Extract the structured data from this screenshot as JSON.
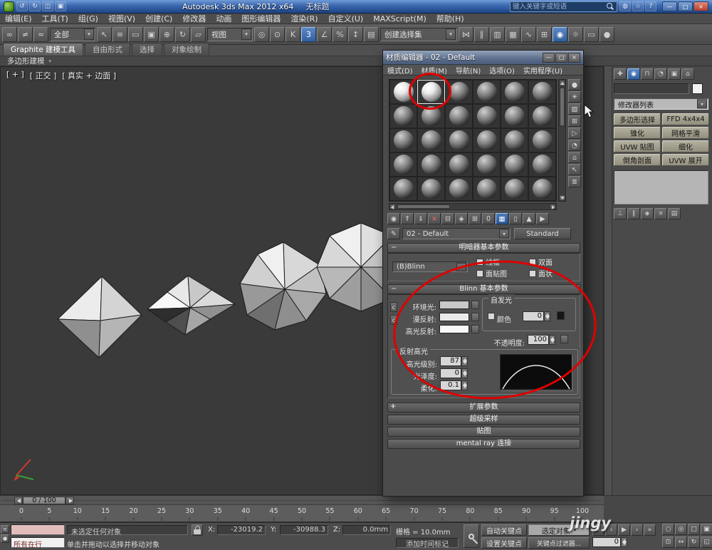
{
  "colors": {
    "annotation_red": "#df0000",
    "accent_blue": "#3a6aa8",
    "ambient": "#c8c8c8",
    "diffuse": "#eaeaea",
    "specular": "#f8f8f8",
    "selfillum_swatch": "#161616"
  },
  "titlebar": {
    "app_title": "Autodesk 3ds Max 2012 x64",
    "doc_title": "无标题",
    "search_placeholder": "键入关键字或短语",
    "qat": [
      {
        "n": "undo-icon",
        "g": "↺"
      },
      {
        "n": "redo-icon",
        "g": "↻"
      },
      {
        "n": "open-file-icon",
        "g": "◫"
      },
      {
        "n": "save-file-icon",
        "g": "▣"
      }
    ],
    "right_icons": [
      {
        "n": "communication-center-icon",
        "g": "◍"
      },
      {
        "n": "favorites-star-icon",
        "g": "☆"
      },
      {
        "n": "help-icon",
        "g": "?"
      }
    ],
    "window_buttons": {
      "minimize": "—",
      "maximize": "□",
      "close": "×"
    }
  },
  "menubar": {
    "items": [
      "编辑(E)",
      "工具(T)",
      "组(G)",
      "视图(V)",
      "创建(C)",
      "修改器",
      "动画",
      "图形编辑器",
      "渲染(R)",
      "自定义(U)",
      "MAXScript(M)",
      "帮助(H)"
    ]
  },
  "toolbar": {
    "icons_a": [
      {
        "n": "select-and-link-icon",
        "g": "∞"
      },
      {
        "n": "unlink-selection-icon",
        "g": "≠"
      },
      {
        "n": "bind-to-space-warp-icon",
        "g": "≈"
      }
    ],
    "selection_filter": "全部",
    "icons_b": [
      {
        "n": "select-object-icon",
        "g": "↖"
      },
      {
        "n": "select-by-name-icon",
        "g": "≡"
      },
      {
        "n": "rectangular-selection-icon",
        "g": "▭"
      },
      {
        "n": "window-crossing-icon",
        "g": "▣"
      },
      {
        "n": "select-and-move-icon",
        "g": "⊕"
      },
      {
        "n": "select-and-rotate-icon",
        "g": "↻"
      },
      {
        "n": "select-and-scale-icon",
        "g": "▱"
      }
    ],
    "coordinate_system": "视图",
    "icons_c": [
      {
        "n": "use-pivot-center-icon",
        "g": "◎"
      },
      {
        "n": "select-and-manipulate-icon",
        "g": "⊙"
      },
      {
        "n": "keyboard-override-icon",
        "g": "K"
      },
      {
        "n": "snap-toggle-3d-icon",
        "g": "3",
        "a": true
      },
      {
        "n": "angle-snap-icon",
        "g": "∠"
      },
      {
        "n": "percent-snap-icon",
        "g": "%"
      },
      {
        "n": "spinner-snap-icon",
        "g": "↕"
      },
      {
        "n": "edit-named-selection-sets-icon",
        "g": "▤"
      }
    ],
    "selection_set": "创建选择集",
    "icons_d": [
      {
        "n": "mirror-icon",
        "g": "⋈"
      },
      {
        "n": "align-icon",
        "g": "∥"
      },
      {
        "n": "layer-manager-icon",
        "g": "▥"
      },
      {
        "n": "graphite-toggle-icon",
        "g": "▦"
      },
      {
        "n": "curve-editor-icon",
        "g": "∿"
      },
      {
        "n": "schematic-view-icon",
        "g": "⊞"
      },
      {
        "n": "material-editor-icon",
        "g": "◉",
        "a": true
      },
      {
        "n": "render-setup-icon",
        "g": "☼"
      },
      {
        "n": "rendered-frame-icon",
        "g": "▭"
      },
      {
        "n": "render-production-icon",
        "g": "●"
      }
    ]
  },
  "ribbon": {
    "tabs": [
      "Graphite 建模工具",
      "自由形式",
      "选择",
      "对象绘制"
    ],
    "panel": "多边形建模"
  },
  "viewport": {
    "overlay": {
      "plus": "[ + ]",
      "view": "[ 正交 ]",
      "shading": "[ 真实 + 边面 ]"
    }
  },
  "material_editor": {
    "title": "材质编辑器 - 02 - Default",
    "window_buttons": {
      "minimize": "—",
      "maximize": "□",
      "close": "×"
    },
    "menu": [
      "模式(D)",
      "材质(M)",
      "导航(N)",
      "选项(O)",
      "实用程序(U)"
    ],
    "sample_slots": {
      "rows": 5,
      "cols": 6,
      "bright_slots": [
        0,
        1
      ],
      "active_slot": 1
    },
    "vertical_tools": [
      {
        "n": "sample-type-icon",
        "g": "●"
      },
      {
        "n": "backlight-icon",
        "g": "☀"
      },
      {
        "n": "background-icon",
        "g": "▨"
      },
      {
        "n": "sample-uv-tiling-icon",
        "g": "⊞"
      },
      {
        "n": "video-color-check-icon",
        "g": "▷"
      },
      {
        "n": "make-preview-icon",
        "g": "◔"
      },
      {
        "n": "material-options-icon",
        "g": "⌂"
      },
      {
        "n": "select-by-material-icon",
        "g": "↖"
      },
      {
        "n": "material-map-navigator-icon",
        "g": "≣"
      }
    ],
    "horizontal_tools": [
      {
        "n": "get-material-icon",
        "g": "◉"
      },
      {
        "n": "put-material-to-scene-icon",
        "g": "⇑"
      },
      {
        "n": "assign-material-to-selection-icon",
        "g": "⇓"
      },
      {
        "n": "reset-map-icon",
        "g": "×",
        "red": true
      },
      {
        "n": "make-material-copy-icon",
        "g": "⊟"
      },
      {
        "n": "make-unique-icon",
        "g": "◈"
      },
      {
        "n": "put-to-library-icon",
        "g": "⊞"
      },
      {
        "n": "material-id-channel-icon",
        "g": "0"
      },
      {
        "n": "show-shaded-material-in-viewport-icon",
        "g": "▦",
        "a": true
      },
      {
        "n": "show-end-result-icon",
        "g": "▯"
      },
      {
        "n": "go-to-parent-icon",
        "g": "▲"
      },
      {
        "n": "go-forward-to-sibling-icon",
        "g": "▶"
      }
    ],
    "pick_icon": "✎",
    "name_field": "02 - Default",
    "type_button": "Standard",
    "rollout_shader": {
      "title": "明暗器基本参数",
      "shader": "(B)Blinn",
      "checks": [
        "线框",
        "双面",
        "面贴图",
        "面状"
      ]
    },
    "rollout_blinn": {
      "title": "Blinn 基本参数",
      "ambient_label": "环境光:",
      "diffuse_label": "漫反射:",
      "specular_label": "高光反射:",
      "selfillum_group": "自发光",
      "color_check": "颜色",
      "selfillum_value": "0",
      "opacity_label": "不透明度:",
      "opacity_value": "100",
      "highlight_group": "反射高光",
      "spec_level_label": "高光级别:",
      "spec_level_value": "87",
      "glossiness_label": "光泽度:",
      "glossiness_value": "0",
      "soften_label": "柔化:",
      "soften_value": "0.1"
    },
    "rollouts_collapsed": [
      "扩展参数",
      "超级采样",
      "贴图",
      "mental ray 连接"
    ]
  },
  "command_panel": {
    "tabs": [
      {
        "n": "create-tab-icon",
        "g": "✚"
      },
      {
        "n": "modify-tab-icon",
        "g": "◉",
        "a": true
      },
      {
        "n": "hierarchy-tab-icon",
        "g": "⊓"
      },
      {
        "n": "motion-tab-icon",
        "g": "◔"
      },
      {
        "n": "display-tab-icon",
        "g": "▣"
      },
      {
        "n": "utilities-tab-icon",
        "g": "⌂"
      }
    ],
    "modifier_list_label": "修改器列表",
    "buttons": [
      "多边形选择",
      "FFD 4x4x4",
      "锥化",
      "网格平滑",
      "UVW 贴图",
      "细化",
      "倒角剖面",
      "UVW 展开"
    ],
    "stack_tools": [
      {
        "n": "pin-stack-icon",
        "g": "⊥"
      },
      {
        "n": "show-end-result-stack-icon",
        "g": "∥"
      },
      {
        "n": "make-unique-stack-icon",
        "g": "◈"
      },
      {
        "n": "remove-modifier-icon",
        "g": "×"
      },
      {
        "n": "configure-modifier-sets-icon",
        "g": "▤"
      }
    ]
  },
  "timeline": {
    "time_display": "0 / 100",
    "ticks": [
      "0",
      "5",
      "10",
      "15",
      "20",
      "25",
      "30",
      "35",
      "40",
      "45",
      "50",
      "55",
      "60",
      "65",
      "70",
      "75",
      "80",
      "85",
      "90",
      "95",
      "100"
    ]
  },
  "statusbar": {
    "left_icons": [
      {
        "n": "maxscript-mini-listener-icon",
        "g": "≡"
      },
      {
        "n": "macro-recorder-icon",
        "g": "●"
      }
    ],
    "listener_text": "所有在行",
    "status_line": "未选定任何对象",
    "x_label": "X:",
    "x_value": "-23019.2",
    "y_label": "Y:",
    "y_value": "-30988.3",
    "z_label": "Z:",
    "z_value": "0.0mm",
    "grid_text": "栅格 = 10.0mm",
    "prompt_line": "单击并拖动以选择并移动对象",
    "add_time_tag": "添加时间标记",
    "auto_key": "自动关键点",
    "selected_mode": "选定对象",
    "set_key": "设置关键点",
    "key_filters": "关键点过滤器...",
    "frame_value": "0",
    "watermark": "jingy",
    "transport": [
      {
        "n": "go-to-start-icon",
        "g": "«"
      },
      {
        "n": "previous-frame-icon",
        "g": "‹"
      },
      {
        "n": "play-icon",
        "g": "▶"
      },
      {
        "n": "next-frame-icon",
        "g": "›"
      },
      {
        "n": "go-to-end-icon",
        "g": "»"
      }
    ],
    "nav_icons": [
      {
        "n": "zoom-icon",
        "g": "○"
      },
      {
        "n": "zoom-all-icon",
        "g": "◎"
      },
      {
        "n": "zoom-extents-icon",
        "g": "□"
      },
      {
        "n": "zoom-extents-all-icon",
        "g": "▣"
      },
      {
        "n": "zoom-region-icon",
        "g": "⊡"
      },
      {
        "n": "pan-icon",
        "g": "↔"
      },
      {
        "n": "orbit-icon",
        "g": "↻"
      },
      {
        "n": "maximize-viewport-icon",
        "g": "◱"
      }
    ]
  }
}
